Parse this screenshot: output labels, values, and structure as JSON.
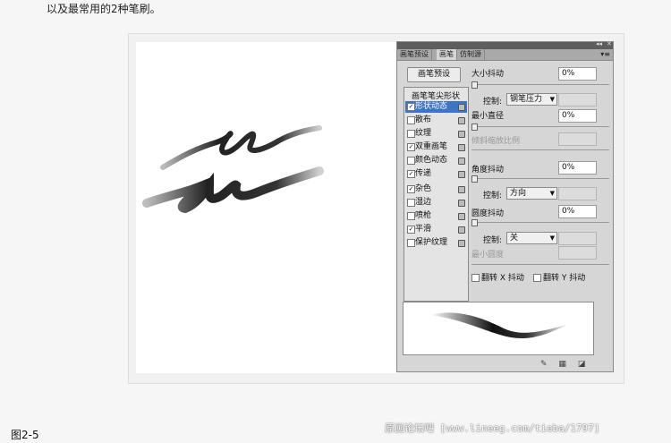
{
  "intro_text": "以及最常用的2种笔刷。",
  "panel": {
    "tabs": [
      "画笔预设",
      "画笔",
      "仿制源"
    ],
    "collapse_icon": "◂◂",
    "close_icon": "✕",
    "menu_icon": "▾≡",
    "preset_button": "画笔预设",
    "list_header": "画笔笔尖形状",
    "items": [
      {
        "label": "形状动态",
        "checked": true,
        "selected": true
      },
      {
        "label": "散布",
        "checked": false
      },
      {
        "label": "纹理",
        "checked": false
      },
      {
        "label": "双重画笔",
        "checked": true
      },
      {
        "label": "颜色动态",
        "checked": false
      },
      {
        "label": "传递",
        "checked": true
      },
      {
        "label": "杂色",
        "checked": true
      },
      {
        "label": "湿边",
        "checked": false
      },
      {
        "label": "喷枪",
        "checked": false
      },
      {
        "label": "平滑",
        "checked": true
      },
      {
        "label": "保护纹理",
        "checked": false
      }
    ],
    "size_jitter_label": "大小抖动",
    "size_jitter_value": "0%",
    "control_label": "控制:",
    "control1_value": "钢笔压力",
    "min_diameter_label": "最小直径",
    "min_diameter_value": "0%",
    "tilt_scale_label": "倾斜缩放比例",
    "angle_jitter_label": "角度抖动",
    "angle_jitter_value": "0%",
    "control2_value": "方向",
    "roundness_jitter_label": "圆度抖动",
    "roundness_jitter_value": "0%",
    "control3_value": "关",
    "min_roundness_label": "最小圆度",
    "flip_x_label": "翻转 X 抖动",
    "flip_y_label": "翻转 Y 抖动",
    "check_mark": "✓"
  },
  "caption": "图2-5",
  "watermark": "[www.lineeg.com/tieba/1797]",
  "watermark_logo": "原画论坛吧"
}
